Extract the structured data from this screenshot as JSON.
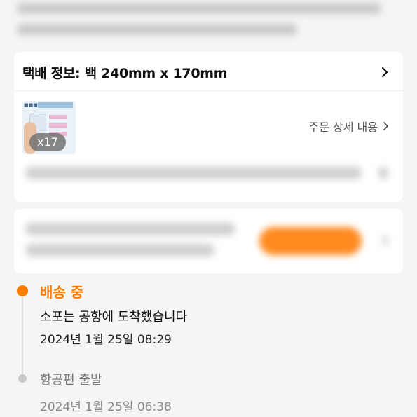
{
  "shipping": {
    "title": "택배 정보: 백 240mm x 170mm"
  },
  "order": {
    "quantity_badge": "x17",
    "detail_link": "주문 상세 내용"
  },
  "timeline": [
    {
      "status": "배송 중",
      "description": "소포는 공항에 도착했습니다",
      "timestamp": "2024년 1월 25일 08:29",
      "active": true
    },
    {
      "description": "항공편 출발",
      "timestamp": "2024년 1월 25일 06:38",
      "active": false
    }
  ],
  "colors": {
    "accent": "#ff7d00",
    "ad_button": "#ff8a1f",
    "inactive_dot": "#c8c8c8"
  },
  "icons": {
    "shipping_chevron": "chevron-right-icon",
    "detail_chevron": "chevron-right-icon"
  }
}
